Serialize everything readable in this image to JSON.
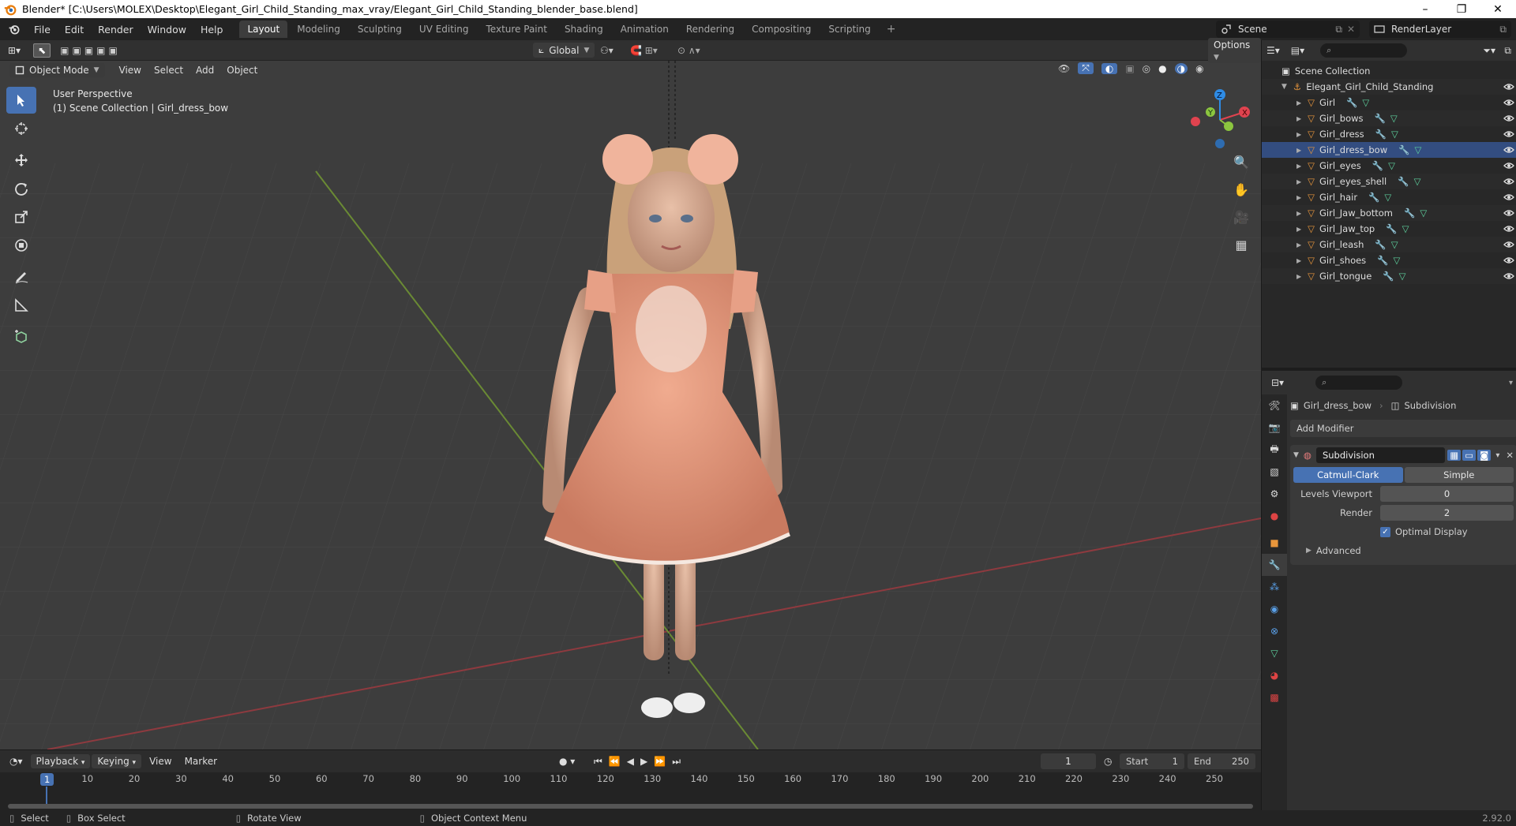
{
  "window": {
    "title": "Blender* [C:\\Users\\MOLEX\\Desktop\\Elegant_Girl_Child_Standing_max_vray/Elegant_Girl_Child_Standing_blender_base.blend]",
    "minimize": "–",
    "maximize": "❐",
    "close": "✕"
  },
  "menu": [
    "File",
    "Edit",
    "Render",
    "Window",
    "Help"
  ],
  "workspaces": [
    "Layout",
    "Modeling",
    "Sculpting",
    "UV Editing",
    "Texture Paint",
    "Shading",
    "Animation",
    "Rendering",
    "Compositing",
    "Scripting"
  ],
  "workspace_add": "+",
  "scene": {
    "name": "Scene",
    "view_layer": "RenderLayer"
  },
  "viewport_header": {
    "mode": "Object Mode",
    "menus": [
      "View",
      "Select",
      "Add",
      "Object"
    ],
    "transform_orientation": "Global",
    "options": "Options"
  },
  "viewport": {
    "perspective": "User Perspective",
    "collection_info": "(1) Scene Collection | Girl_dress_bow",
    "gizmo": {
      "x": "X",
      "y": "Y",
      "z": "Z"
    }
  },
  "tools": [
    "select-box-icon",
    "cursor-icon",
    "move-icon",
    "rotate-icon",
    "scale-icon",
    "transform-icon",
    "annotate-icon",
    "measure-icon",
    "add-cube-icon"
  ],
  "outliner": {
    "root": "Scene Collection",
    "collection": "Elegant_Girl_Child_Standing",
    "items": [
      "Girl",
      "Girl_bows",
      "Girl_dress",
      "Girl_dress_bow",
      "Girl_eyes",
      "Girl_eyes_shell",
      "Girl_hair",
      "Girl_Jaw_bottom",
      "Girl_Jaw_top",
      "Girl_leash",
      "Girl_shoes",
      "Girl_tongue"
    ],
    "selected": "Girl_dress_bow"
  },
  "properties": {
    "object": "Girl_dress_bow",
    "modifier_crumb": "Subdivision",
    "add_modifier": "Add Modifier",
    "modifier": {
      "name": "Subdivision",
      "mode_catmull": "Catmull-Clark",
      "mode_simple": "Simple",
      "levels_label": "Levels Viewport",
      "levels_value": "0",
      "render_label": "Render",
      "render_value": "2",
      "optimal_display": "Optimal Display",
      "advanced": "Advanced"
    }
  },
  "timeline": {
    "menus": [
      "Playback",
      "Keying",
      "View",
      "Marker"
    ],
    "current_frame": "1",
    "start_label": "Start",
    "start_value": "1",
    "end_label": "End",
    "end_value": "250",
    "ticks": [
      "1",
      "10",
      "20",
      "30",
      "40",
      "50",
      "60",
      "70",
      "80",
      "90",
      "100",
      "110",
      "120",
      "130",
      "140",
      "150",
      "160",
      "170",
      "180",
      "190",
      "200",
      "210",
      "220",
      "230",
      "240",
      "250"
    ]
  },
  "status": {
    "select": "Select",
    "box_select": "Box Select",
    "rotate_view": "Rotate View",
    "context_menu": "Object Context Menu",
    "version": "2.92.0"
  },
  "colors": {
    "accent": "#4772b3",
    "selected_row": "#334d80",
    "x_axis": "#e0434f",
    "y_axis": "#8cc63f",
    "z_axis": "#2e8ce6",
    "dress": "#e39a7f"
  }
}
